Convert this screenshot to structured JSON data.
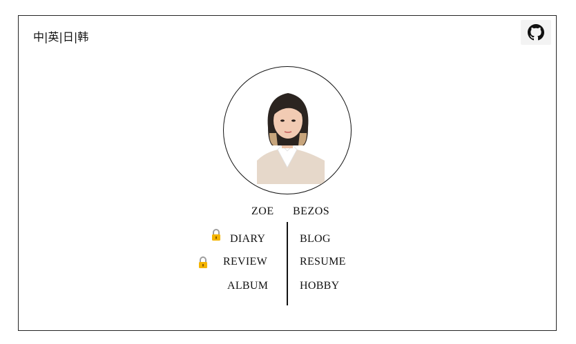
{
  "header": {
    "languages": [
      "中",
      "英",
      "日",
      "韩"
    ],
    "separator": "|"
  },
  "github": {
    "icon": "github-icon"
  },
  "profile": {
    "first_name": "ZOE",
    "last_name": "BEZOS"
  },
  "nav": {
    "left": [
      {
        "label": "DIARY",
        "locked": true
      },
      {
        "label": "REVIEW",
        "locked": true
      },
      {
        "label": "ALBUM",
        "locked": false
      }
    ],
    "right": [
      {
        "label": "BLOG"
      },
      {
        "label": "RESUME"
      },
      {
        "label": "HOBBY"
      }
    ]
  },
  "colors": {
    "lock": "#f4b400",
    "border": "#222222"
  }
}
